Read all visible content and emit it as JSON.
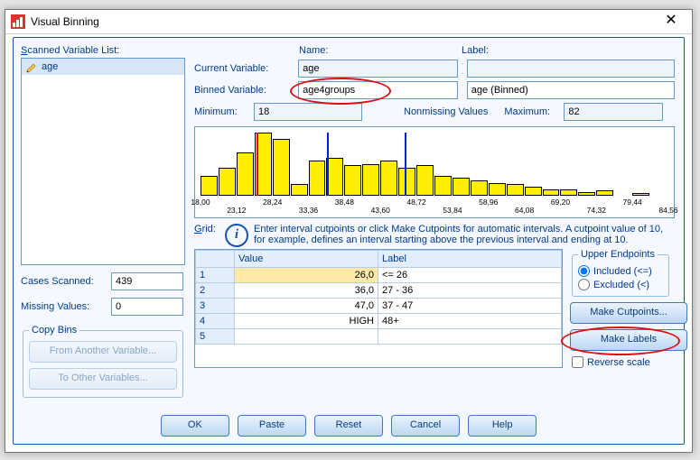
{
  "window": {
    "title": "Visual Binning",
    "close_glyph": "✕"
  },
  "left": {
    "scanned_label": "Scanned Variable List:",
    "scanned_label_ukey": "S",
    "variables": [
      {
        "name": "age"
      }
    ],
    "cases_scanned_label": "Cases Scanned:",
    "cases_scanned": "439",
    "missing_label": "Missing Values:",
    "missing": "0",
    "copy_legend": "Copy Bins",
    "from_btn": "From Another Variable...",
    "to_btn": "To Other Variables..."
  },
  "top": {
    "name_label": "Name:",
    "label_label": "Label:",
    "current_label": "Current Variable:",
    "current_name": "age",
    "current_lbl": "",
    "binned_label": "Binned Variable:",
    "binned_label_ukey": "B",
    "binned_name": "age4groups",
    "binned_lbl": "age (Binned)",
    "min_label": "Minimum:",
    "min": "18",
    "nonmissing_label": "Nonmissing Values",
    "max_label": "Maximum:",
    "max": "82"
  },
  "hist": {
    "chart_data": {
      "type": "histogram",
      "x_start": 18.0,
      "x_end": 84.56,
      "bin_width": 2.56,
      "values": [
        16,
        22,
        34,
        50,
        45,
        9,
        28,
        30,
        24,
        25,
        28,
        22,
        24,
        16,
        14,
        12,
        10,
        9,
        7,
        5,
        5,
        3,
        4,
        0,
        2,
        0
      ],
      "cutpoints": [
        26.0,
        36.0,
        47.0
      ],
      "cutcolors": [
        "#d11",
        "#0022dd",
        "#0022dd"
      ],
      "ticks_top": [
        "18,00",
        "28,24",
        "38,48",
        "48,72",
        "58,96",
        "69,20",
        "79,44"
      ],
      "ticks_bot": [
        "23,12",
        "33,36",
        "43,60",
        "53,84",
        "64,08",
        "74,32",
        "84,56"
      ]
    }
  },
  "info": {
    "text": "Enter interval cutpoints or click Make Cutpoints for automatic intervals. A cutpoint value of 10, for example, defines an interval starting above the previous interval and ending at 10."
  },
  "grid": {
    "label": "Grid:",
    "label_ukey": "G",
    "headers": {
      "value": "Value",
      "label": "Label"
    },
    "rows": [
      {
        "n": "1",
        "value": "26,0",
        "label": "<= 26",
        "selected": true
      },
      {
        "n": "2",
        "value": "36,0",
        "label": "27 - 36"
      },
      {
        "n": "3",
        "value": "47,0",
        "label": "37 - 47"
      },
      {
        "n": "4",
        "value": "HIGH",
        "label": "48+"
      },
      {
        "n": "5",
        "value": "",
        "label": ""
      }
    ]
  },
  "side": {
    "upper_legend": "Upper Endpoints",
    "included": "Included (<=)",
    "included_ukey": "I",
    "excluded": "Excluded (<)",
    "excluded_ukey": "E",
    "make_cut": "Make Cutpoints...",
    "make_lab": "Make Labels",
    "reverse": "Reverse scale"
  },
  "footer": {
    "ok": "OK",
    "paste": "Paste",
    "reset": "Reset",
    "cancel": "Cancel",
    "help": "Help"
  },
  "colors": {
    "accent": "#1753a9",
    "bar": "#ffee00"
  }
}
